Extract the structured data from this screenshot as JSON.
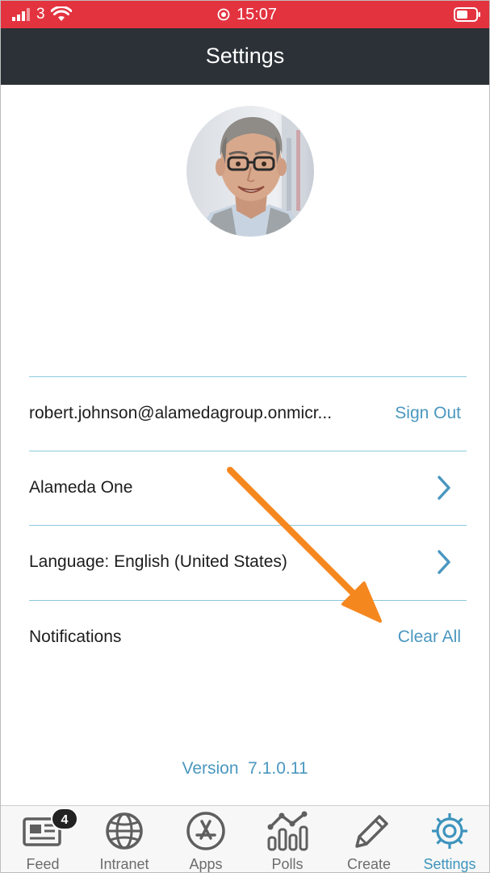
{
  "status_bar": {
    "carrier": "3",
    "time": "15:07",
    "background_color": "#e3333f"
  },
  "nav": {
    "title": "Settings"
  },
  "profile": {
    "avatar_icon": "avatar-photo"
  },
  "rows": {
    "account": {
      "email": "robert.johnson@alamedagroup.onmicr...",
      "action": "Sign Out"
    },
    "tenant": {
      "label": "Alameda One",
      "icon": "chevron-right-icon"
    },
    "language": {
      "label": "Language: English (United States)",
      "icon": "chevron-right-icon"
    },
    "notifications": {
      "label": "Notifications",
      "action": "Clear All"
    }
  },
  "annotation": {
    "icon": "orange-arrow",
    "color": "#f5871f"
  },
  "version": {
    "text": "Version  7.1.0.11"
  },
  "tab_bar": {
    "items": [
      {
        "label": "Feed",
        "icon": "newspaper-icon",
        "badge": "4"
      },
      {
        "label": "Intranet",
        "icon": "globe-icon"
      },
      {
        "label": "Apps",
        "icon": "app-store-icon"
      },
      {
        "label": "Polls",
        "icon": "poll-chart-icon"
      },
      {
        "label": "Create",
        "icon": "pencil-icon"
      },
      {
        "label": "Settings",
        "icon": "gear-icon",
        "active": true
      }
    ],
    "active_color": "#3d94bd"
  },
  "colors": {
    "accent": "#4a97bf",
    "divider": "#8cc9df",
    "nav_background": "#2b3136"
  }
}
